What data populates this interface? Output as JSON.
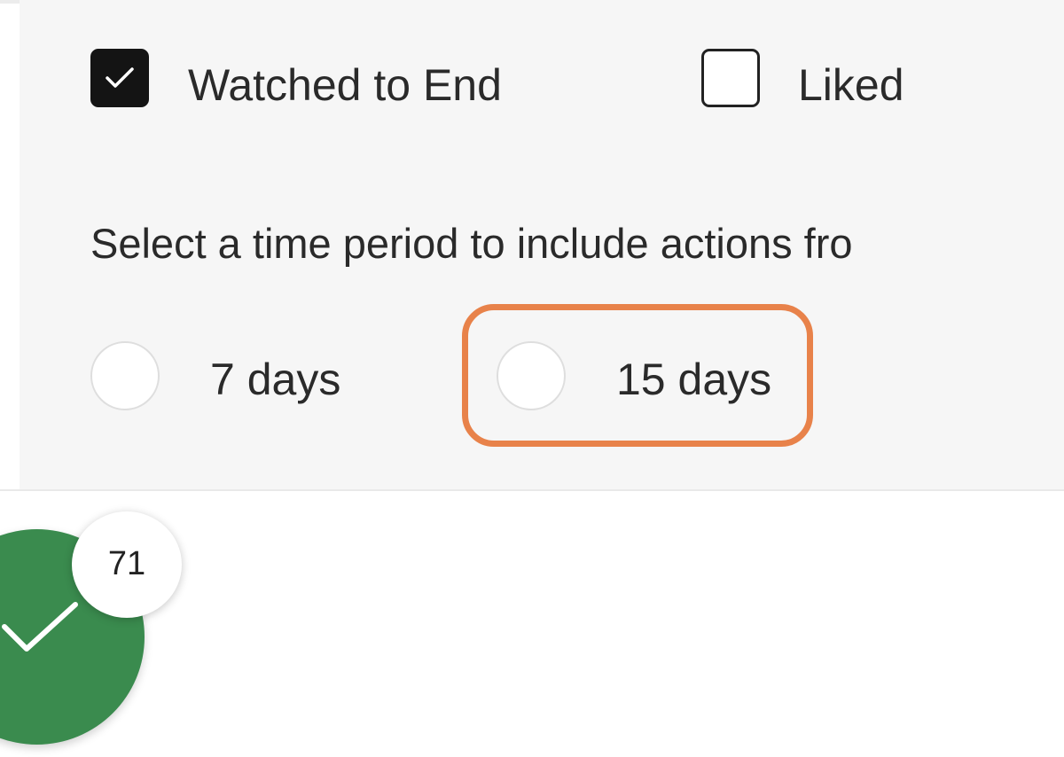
{
  "filters": {
    "checkboxes": [
      {
        "label": "Watched to End",
        "checked": true
      },
      {
        "label": "Liked",
        "checked": false
      }
    ],
    "time_period": {
      "prompt": "Select a time period to include actions fro",
      "options": [
        {
          "label": "7 days",
          "selected": false
        },
        {
          "label": "15 days",
          "selected": false
        }
      ]
    }
  },
  "highlight": {
    "target": "15 days",
    "color": "#e8824a"
  },
  "fab": {
    "icon": "check-icon",
    "color": "#3a8b4e",
    "badge_count": "71"
  }
}
